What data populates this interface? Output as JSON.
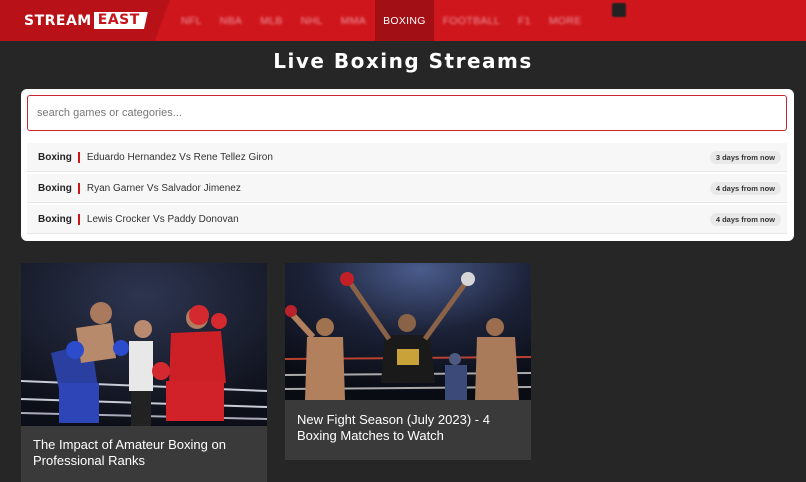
{
  "header": {
    "logo_left": "STREAM",
    "logo_right": "EAST",
    "nav": [
      {
        "label": "NFL"
      },
      {
        "label": "NBA"
      },
      {
        "label": "MLB"
      },
      {
        "label": "NHL"
      },
      {
        "label": "MMA"
      },
      {
        "label": "BOXING",
        "active": true
      },
      {
        "label": "FOOTBALL"
      },
      {
        "label": "F1"
      },
      {
        "label": "MORE"
      }
    ]
  },
  "page": {
    "title": "Live Boxing Streams"
  },
  "search": {
    "placeholder": "search games or categories...",
    "value": ""
  },
  "events": [
    {
      "category": "Boxing",
      "name": "Eduardo Hernandez Vs Rene Tellez Giron",
      "time": "3 days from now"
    },
    {
      "category": "Boxing",
      "name": "Ryan Garner Vs Salvador Jimenez",
      "time": "4 days from now"
    },
    {
      "category": "Boxing",
      "name": "Lewis Crocker Vs Paddy Donovan",
      "time": "4 days from now"
    }
  ],
  "articles": [
    {
      "title": "The Impact of Amateur Boxing on Professional Ranks"
    },
    {
      "title": "New Fight Season (July 2023) - 4 Boxing Matches to Watch"
    }
  ],
  "colors": {
    "brand_red": "#d0161d",
    "brand_dark_red": "#a20f14",
    "background": "#262626",
    "card_caption_bg": "#3a3a3a"
  }
}
